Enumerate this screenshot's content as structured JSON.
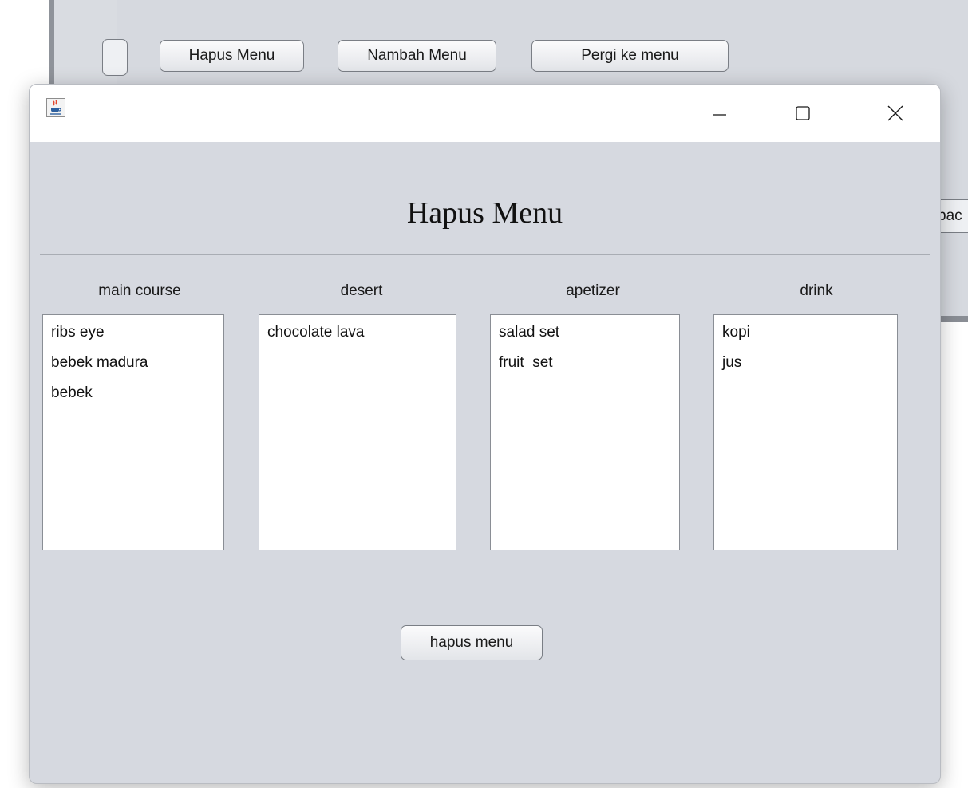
{
  "background_window": {
    "buttons": [
      {
        "label": "Hapus Menu"
      },
      {
        "label": "Nambah Menu"
      },
      {
        "label": "Pergi ke menu"
      }
    ],
    "partial_right_button": "bac"
  },
  "dialog": {
    "title": "Hapus Menu",
    "columns": [
      {
        "header": "main course",
        "items": [
          "ribs eye",
          "bebek madura",
          "bebek"
        ]
      },
      {
        "header": "desert",
        "items": [
          "chocolate lava"
        ]
      },
      {
        "header": "apetizer",
        "items": [
          "salad set",
          "fruit  set"
        ]
      },
      {
        "header": "drink",
        "items": [
          "kopi",
          "jus"
        ]
      }
    ],
    "action_button": "hapus menu"
  },
  "icons": {
    "app": "java-coffee-icon",
    "minimize": "minimize-icon",
    "maximize": "maximize-icon",
    "close": "close-icon"
  },
  "colors": {
    "panel_background": "#d6d9e0",
    "titlebar": "#ffffff",
    "list_background": "#ffffff"
  }
}
